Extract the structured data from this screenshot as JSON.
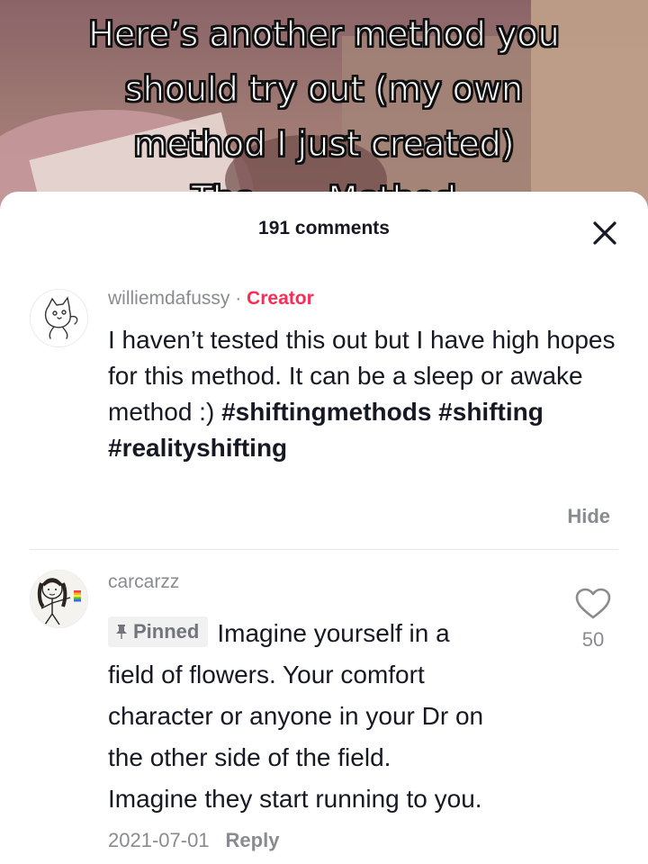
{
  "video": {
    "caption_lines": [
      "Here’s another method you",
      "should try out (my own",
      "method I just created)",
      "The ___ Method"
    ]
  },
  "sheet": {
    "comment_count": "191 comments",
    "close_icon": "close-icon"
  },
  "comments": [
    {
      "username": "williemdafussy",
      "separator": " · ",
      "role_label": "Creator",
      "text": "I haven’t tested this out but I have high hopes for this method. It can be a sleep or awake method :)",
      "hashtags": "#shiftingmethods #shifting #realityshifting",
      "action_label": "Hide",
      "avatar_icon": "cat-drawing-avatar"
    },
    {
      "username": "carcarzz",
      "pinned_label": "Pinned",
      "pin_icon": "pin-icon",
      "text_lines": [
        "Imagine yourself in a",
        "field of flowers. Your comfort",
        "character or anyone in your Dr on",
        "the other side of the field.",
        "Imagine they start running to you."
      ],
      "date": "2021-07-01",
      "reply_label": "Reply",
      "like_count": "50",
      "like_icon": "heart-outline-icon",
      "avatar_icon": "stick-figure-avatar"
    }
  ],
  "colors": {
    "creator": "#fe2c55",
    "muted": "#8a8b91",
    "text": "#161823"
  }
}
